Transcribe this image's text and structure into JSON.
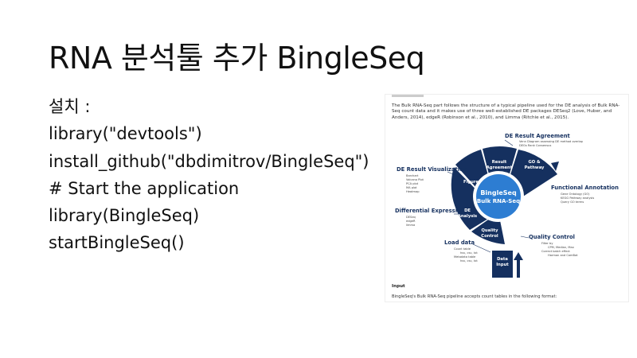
{
  "slide": {
    "title": "RNA 분석툴 추가 BingleSeq",
    "install_lines": [
      "설치 :",
      "library(\"devtools\")",
      "install_github(\"dbdimitrov/BingleSeq\")",
      "# Start the application",
      "library(BingleSeq)",
      "startBingleSeq()"
    ]
  },
  "figure": {
    "intro_text": "The Bulk RNA-Seq part follows the structure of a typical pipeline used for the DE analysis of Bulk RNA-Seq count data and it makes use of three well-established DE packages DESeq2 (Love, Huber, and Anders, 2014), edgeR (Robinson et al., 2010), and Limma (Ritchie et al., 2015).",
    "center_title_1": "BingleSeq",
    "center_title_2": "Bulk RNA-Seq",
    "segments": {
      "result_agreement": [
        "Result",
        "Agreement"
      ],
      "go_pathway": [
        "GO &",
        "Pathway"
      ],
      "figures": [
        "Figures"
      ],
      "de_analysis": [
        "DE",
        "Analysis"
      ],
      "quality_control": [
        "Quality",
        "Control"
      ],
      "data_input": [
        "Data",
        "Input"
      ]
    },
    "callouts": {
      "de_result_agreement": {
        "title": "DE Result Agreement",
        "items": [
          "Venn Diagram assessing DE method overlap",
          "DEGs Rank Consensus"
        ]
      },
      "de_result_visualization": {
        "title": "DE Result Visualization",
        "items": [
          "Barchart",
          "Volcano Plot",
          "PCA plot",
          "MA plot",
          "Heatmap"
        ]
      },
      "functional_annotation": {
        "title": "Functional Annotation",
        "items": [
          "Gene Ontology (GO)",
          "KEGG Pathway analysis",
          "Query GO terms"
        ]
      },
      "differential_expression": {
        "title": "Differential Expression",
        "items": [
          "DESeq",
          "edgeR",
          "limma"
        ]
      },
      "quality_control": {
        "title": "Quality Control",
        "items": [
          "Filter by",
          "CPM, Median, Max",
          "Correct batch effect",
          "Harman and ComBat"
        ]
      },
      "load_data": {
        "title": "Load data",
        "items": [
          "Count table",
          "hsv, csv, txt",
          "Metadata table",
          "hsv, csv, txt"
        ]
      }
    },
    "input_heading": "Input",
    "input_text": "BingleSeq's Bulk RNA-Seq pipeline accepts count tables in the following format:",
    "colors": {
      "navy": "#15305f",
      "blue": "#2d7dd2",
      "text": "#222222"
    }
  }
}
